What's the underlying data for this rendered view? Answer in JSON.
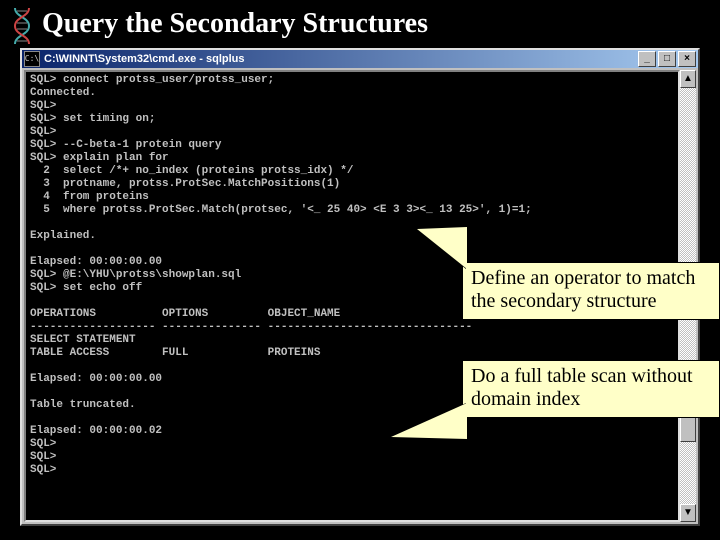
{
  "slide": {
    "title": "Query the Secondary Structures"
  },
  "window": {
    "icon_label": "C:\\",
    "title": "C:\\WINNT\\System32\\cmd.exe - sqlplus",
    "buttons": {
      "min": "_",
      "max": "□",
      "close": "×"
    },
    "scroll": {
      "up": "▲",
      "down": "▼"
    }
  },
  "terminal": {
    "text": "SQL> connect protss_user/protss_user;\nConnected.\nSQL>\nSQL> set timing on;\nSQL>\nSQL> --C-beta-1 protein query\nSQL> explain plan for\n  2  select /*+ no_index (proteins protss_idx) */\n  3  protname, protss.ProtSec.MatchPositions(1)\n  4  from proteins\n  5  where protss.ProtSec.Match(protsec, '<_ 25 40> <E 3 3><_ 13 25>', 1)=1;\n\nExplained.\n\nElapsed: 00:00:00.00\nSQL> @E:\\YHU\\protss\\showplan.sql\nSQL> set echo off\n\nOPERATIONS          OPTIONS         OBJECT_NAME\n------------------- --------------- -------------------------------\nSELECT STATEMENT\nTABLE ACCESS        FULL            PROTEINS\n\nElapsed: 00:00:00.00\n\nTable truncated.\n\nElapsed: 00:00:00.02\nSQL>\nSQL>\nSQL>"
  },
  "callouts": {
    "c1": "Define an operator to match the secondary structure",
    "c2": "Do a full table scan without domain index"
  }
}
